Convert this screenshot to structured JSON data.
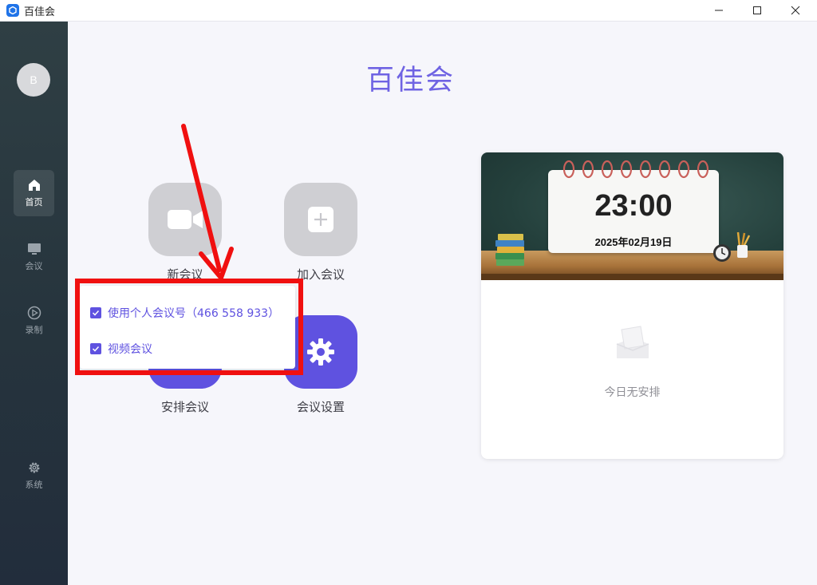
{
  "window": {
    "title": "百佳会"
  },
  "sidebar": {
    "avatar_initial": "B",
    "items": [
      {
        "label": "首页",
        "icon": "home-icon",
        "active": true
      },
      {
        "label": "会议",
        "icon": "monitor-icon",
        "active": false
      },
      {
        "label": "录制",
        "icon": "play-circle-icon",
        "active": false
      },
      {
        "label": "系统",
        "icon": "gear-icon",
        "active": false
      }
    ]
  },
  "main": {
    "title": "百佳会",
    "actions": [
      {
        "label": "新会议",
        "icon": "video-camera-icon",
        "color": "#cfcfd3"
      },
      {
        "label": "加入会议",
        "icon": "plus-icon",
        "color": "#cfcfd3"
      },
      {
        "label": "安排会议",
        "icon": "calendar-icon",
        "color": "#5f52e0"
      },
      {
        "label": "会议设置",
        "icon": "gear-icon",
        "color": "#5f52e0"
      }
    ],
    "dropdown": [
      {
        "label": "使用个人会议号（466 558 933）",
        "checked": true
      },
      {
        "label": "视频会议",
        "checked": true
      }
    ]
  },
  "calendar": {
    "time": "23:00",
    "date": "2025年02月19日",
    "empty_text": "今日无安排"
  },
  "colors": {
    "accent": "#6f63e3",
    "primary": "#5f52e0",
    "annotation": "#f01010"
  }
}
